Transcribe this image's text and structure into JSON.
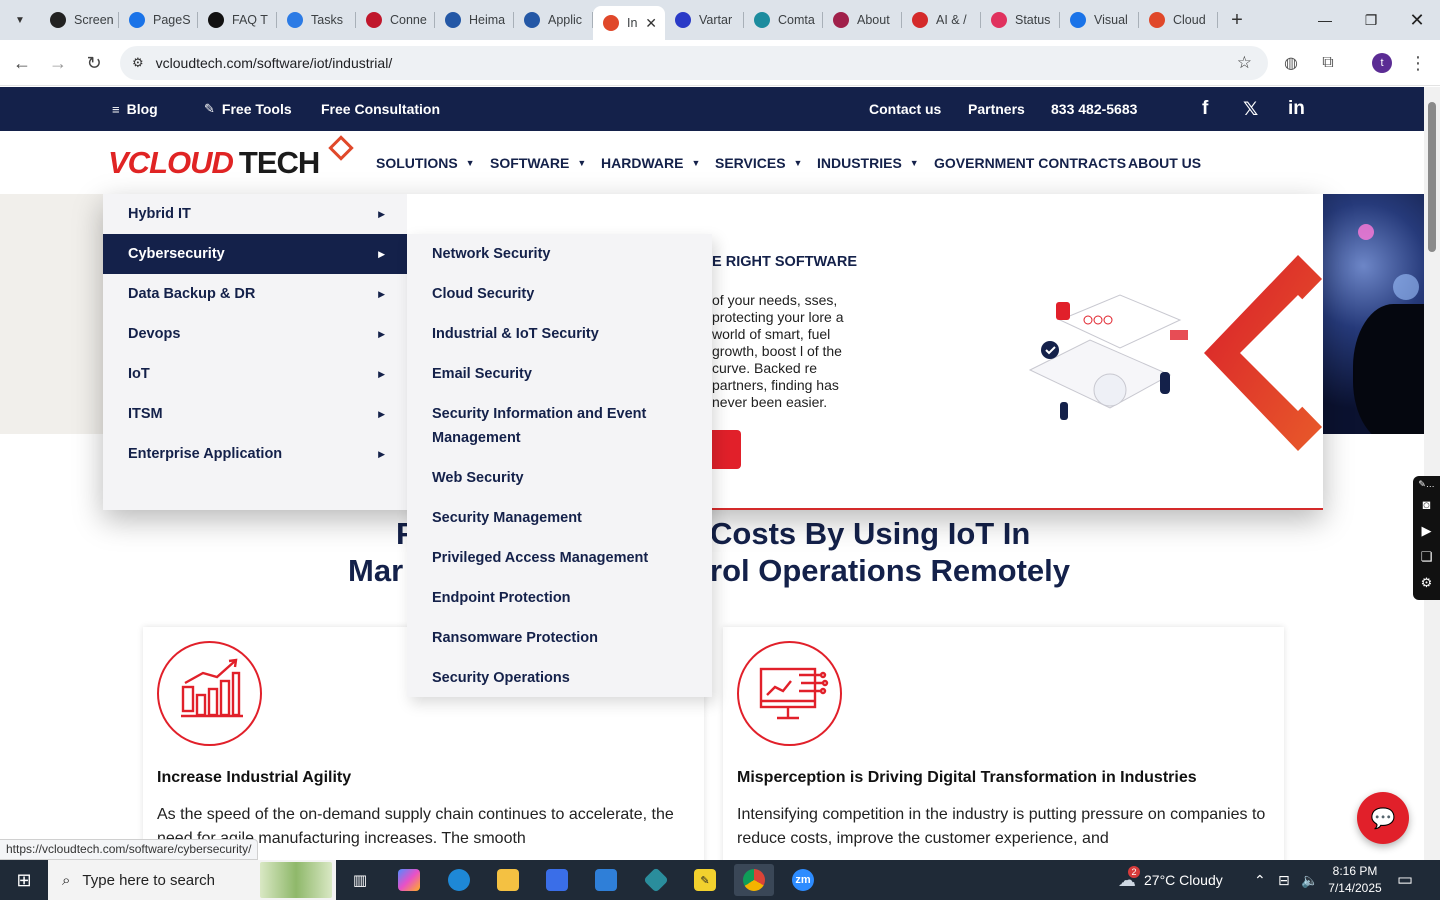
{
  "browser": {
    "tabs": [
      {
        "label": "Screen",
        "icon": "screencast-icon",
        "color": "#222222"
      },
      {
        "label": "PageS",
        "icon": "pagespeed-icon",
        "color": "#1a73e8"
      },
      {
        "label": "FAQ T",
        "icon": "faq-icon",
        "color": "#111111"
      },
      {
        "label": "Tasks",
        "icon": "tasks-icon",
        "color": "#2c7be5"
      },
      {
        "label": "Conne",
        "icon": "vcloud-v-icon",
        "color": "#c0172c"
      },
      {
        "label": "Heima",
        "icon": "heimdal-icon",
        "color": "#2458a6"
      },
      {
        "label": "Applic",
        "icon": "application-icon",
        "color": "#2458a6"
      },
      {
        "label": "In",
        "icon": "vcloud-diamond-icon",
        "color": "#e0482a",
        "active": true
      },
      {
        "label": "Vartar",
        "icon": "vartana-icon",
        "color": "#2a3ac7"
      },
      {
        "label": "Comta",
        "icon": "comtac-icon",
        "color": "#1c8c9e"
      },
      {
        "label": "About",
        "icon": "about-icon",
        "color": "#a0204a"
      },
      {
        "label": "AI & /",
        "icon": "vcloud-diamond-icon",
        "color": "#d42a2a"
      },
      {
        "label": "Status",
        "icon": "status-icon",
        "color": "#e0325e"
      },
      {
        "label": "Visual",
        "icon": "visual-icon",
        "color": "#1a73e8"
      },
      {
        "label": "Cloud",
        "icon": "cloud-icon",
        "color": "#e0482a"
      }
    ],
    "url": "vcloudtech.com/software/iot/industrial/",
    "profile_initial": "t",
    "status_url": "https://vcloudtech.com/software/cybersecurity/"
  },
  "site": {
    "topbar": {
      "blog": "Blog",
      "free_tools": "Free Tools",
      "free_consultation": "Free Consultation",
      "contact": "Contact us",
      "partners": "Partners",
      "phone": "833 482-5683",
      "social": [
        "f",
        "𝕏",
        "in"
      ]
    },
    "logo": {
      "part1": "VCLOUD",
      "part2": "TECH"
    },
    "nav": [
      "SOLUTIONS",
      "SOFTWARE",
      "HARDWARE",
      "SERVICES",
      "INDUSTRIES",
      "GOVERNMENT CONTRACTS",
      "ABOUT US"
    ],
    "menu_level1": [
      "Hybrid IT",
      "Cybersecurity",
      "Data Backup & DR",
      "Devops",
      "IoT",
      "ITSM",
      "Enterprise Application"
    ],
    "menu_level1_active": 1,
    "menu_level2": [
      "Network Security",
      "Cloud Security",
      "Industrial & IoT Security",
      "Email Security",
      "Security Information and Event Management",
      "Web Security",
      "Security Management",
      "Privileged Access Management",
      "Endpoint Protection",
      "Ransomware Protection",
      "Security Operations"
    ],
    "hero": {
      "heading": "IE RIGHT SOFTWARE",
      "text": "of your needs, sses, protecting your lore a world of smart, fuel growth, boost l of the curve. Backed re partners, finding has never been easier."
    },
    "section_heading": {
      "line1_left": "F",
      "line1_right": "Costs By Using IoT In",
      "line2_left": "Mar",
      "line2_right": "rol Operations Remotely"
    },
    "cards": [
      {
        "title": "Increase Industrial Agility",
        "body": "As the speed of the on-demand supply chain continues to accelerate, the need for agile manufacturing increases. The smooth"
      },
      {
        "title": "Misperception is Driving Digital Transformation in Industries",
        "body": "Intensifying competition in the industry is putting pressure on companies to reduce costs, improve the customer experience, and"
      }
    ]
  },
  "taskbar": {
    "search_placeholder": "Type here to search",
    "weather": "27°C  Cloudy",
    "weather_badge": "2",
    "time": "8:16 PM",
    "date": "7/14/2025"
  },
  "colors": {
    "navy": "#14214a",
    "red": "#e1202a"
  }
}
